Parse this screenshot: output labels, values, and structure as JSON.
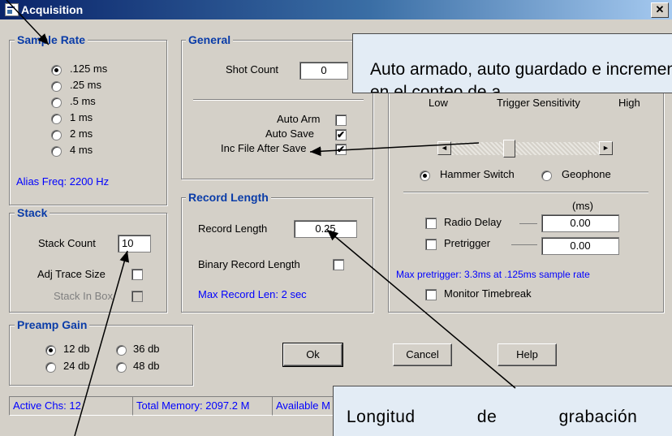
{
  "window": {
    "title": "Acquisition",
    "close_glyph": "✕"
  },
  "sample_rate": {
    "title": "Sample Rate",
    "options": [
      ".125 ms",
      ".25 ms",
      ".5 ms",
      "1 ms",
      "2 ms",
      "4 ms"
    ],
    "selected": ".125 ms",
    "alias_freq": "Alias Freq: 2200 Hz"
  },
  "general": {
    "title": "General",
    "shot_count_label": "Shot Count",
    "shot_count_value": "0",
    "auto_arm_label": "Auto Arm",
    "auto_arm_checked": false,
    "auto_save_label": "Auto Save",
    "auto_save_checked": true,
    "inc_file_label": "Inc File After Save",
    "inc_file_checked": true
  },
  "trigger": {
    "low_label": "Low",
    "sensitivity_label": "Trigger Sensitivity",
    "high_label": "High",
    "slider_left_arrow": "◄",
    "slider_right_arrow": "►",
    "hammer_label": "Hammer Switch",
    "geophone_label": "Geophone",
    "selected_source": "Hammer Switch",
    "units_label": "(ms)",
    "radio_delay_label": "Radio Delay",
    "radio_delay_checked": false,
    "radio_delay_value": "0.00",
    "pretrigger_label": "Pretrigger",
    "pretrigger_checked": false,
    "pretrigger_value": "0.00",
    "max_pretrigger": "Max pretrigger: 3.3ms  at .125ms sample rate",
    "monitor_label": "Monitor Timebreak",
    "monitor_checked": false
  },
  "record_length": {
    "title": "Record Length",
    "label": "Record Length",
    "value": "0.25",
    "binary_label": "Binary Record Length",
    "binary_checked": false,
    "max_label": "Max Record Len: 2 sec"
  },
  "stack": {
    "title": "Stack",
    "count_label": "Stack Count",
    "count_value": "10",
    "adj_label": "Adj Trace Size",
    "adj_checked": false,
    "in_box_label": "Stack In Box",
    "in_box_checked": false
  },
  "preamp": {
    "title": "Preamp Gain",
    "options": [
      "12 db",
      "36 db",
      "24 db",
      "48 db"
    ],
    "selected": "12 db"
  },
  "buttons": {
    "ok": "Ok",
    "cancel": "Cancel",
    "help": "Help"
  },
  "status": {
    "active_chs": "Active Chs: 12",
    "total_memory": "Total Memory: 2097.2 M",
    "available": "Available M"
  },
  "check_glyph": "✔",
  "callouts": {
    "top": "Auto armado, auto guardado e incremento en el conteo de a",
    "bottom": "Longitud de grabación"
  },
  "colors": {
    "group_title": "#0a3ca8",
    "info_text": "#0000ff",
    "dialog_bg": "#d4d0c8",
    "callout_bg": "#e3ecf5"
  }
}
